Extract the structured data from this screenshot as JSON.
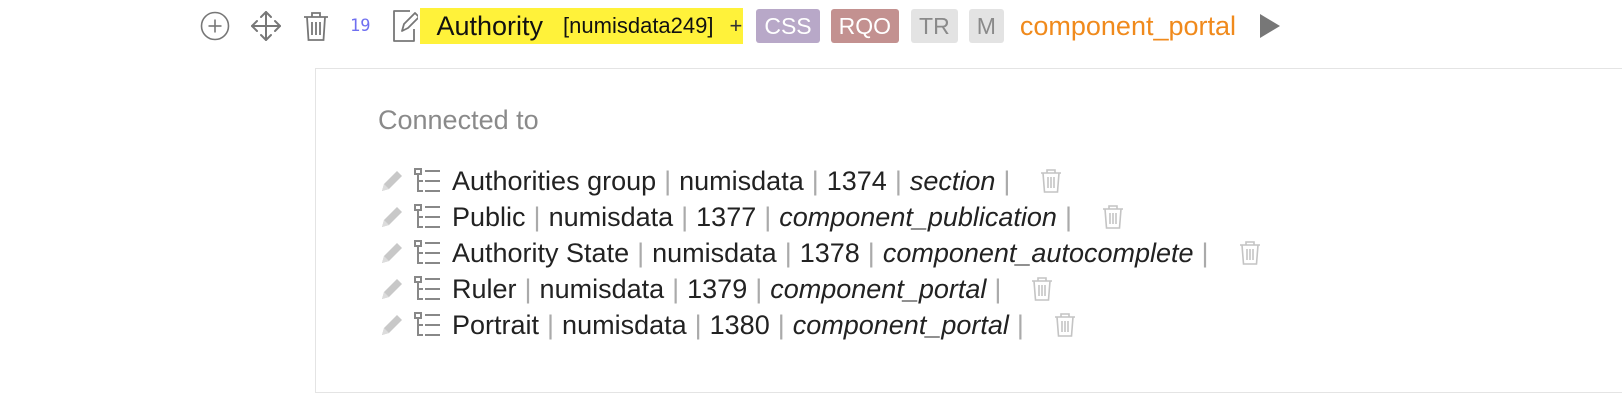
{
  "toolbar": {
    "icons": [
      "add-circle-icon",
      "move-arrows-icon",
      "trash-icon",
      "edit-document-icon",
      "play-icon"
    ],
    "count": "19",
    "title": "Authority",
    "tipo": "[numisdata249]",
    "plus": "+",
    "tags": {
      "css": "CSS",
      "rqo": "RQO",
      "tr": "TR",
      "m": "M"
    },
    "model": "component_portal"
  },
  "colors": {
    "highlight": "#fff23a",
    "count": "#6f6ff0",
    "model": "#f08a1c",
    "css_tag": "#b8a8c8",
    "rqo_tag": "#c39190",
    "muted_tag": "#e3e3e3"
  },
  "panel": {
    "label": "Connected to",
    "separator": "|",
    "rows": [
      {
        "name": "Authorities group",
        "tld": "numisdata",
        "id": "1374",
        "model": "section"
      },
      {
        "name": "Public",
        "tld": "numisdata",
        "id": "1377",
        "model": "component_publication"
      },
      {
        "name": "Authority State",
        "tld": "numisdata",
        "id": "1378",
        "model": "component_autocomplete"
      },
      {
        "name": "Ruler",
        "tld": "numisdata",
        "id": "1379",
        "model": "component_portal"
      },
      {
        "name": "Portrait",
        "tld": "numisdata",
        "id": "1380",
        "model": "component_portal"
      }
    ]
  }
}
